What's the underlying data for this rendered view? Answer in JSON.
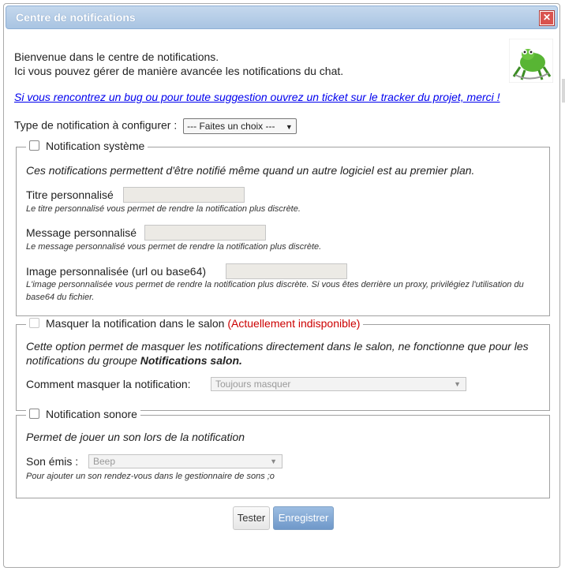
{
  "dialog": {
    "title": "Centre de notifications",
    "close_glyph": "✕"
  },
  "intro": {
    "line1": "Bienvenue dans le centre de notifications.",
    "line2": "Ici vous pouvez gérer de manière avancée les notifications du chat."
  },
  "bug_link": "Si vous rencontrez un bug ou pour toute suggestion ouvrez un ticket sur le tracker du projet, merci !",
  "type_select": {
    "label": "Type de notification à configurer :",
    "value": "--- Faites un choix ---"
  },
  "system": {
    "legend": "Notification système",
    "description": "Ces notifications permettent d'être notifié même quand un autre logiciel est au premier plan.",
    "title_label": "Titre personnalisé",
    "title_hint": "Le titre personnalisé vous permet de rendre la notification plus discrète.",
    "message_label": "Message personnalisé",
    "message_hint": "Le message personnalisé vous permet de rendre la notification plus discrète.",
    "image_label": "Image personnalisée (url ou base64)",
    "image_hint": "L'image personnalisée vous permet de rendre la notification plus discrète. Si vous êtes derrière un proxy, privilégiez l'utilisation du base64 du fichier."
  },
  "hide": {
    "legend": "Masquer la notification dans le salon",
    "unavailable": "(Actuellement indisponible)",
    "description": "Cette option permet de masquer les notifications directement dans le salon, ne fonctionne que pour les notifications du groupe",
    "description_bold": "Notifications salon.",
    "mode_label": "Comment masquer la notification:",
    "mode_value": "Toujours masquer"
  },
  "sound": {
    "legend": "Notification sonore",
    "description": "Permet de jouer un son lors de la notification",
    "sound_label": "Son émis :",
    "sound_value": "Beep",
    "hint": "Pour ajouter un son rendez-vous dans le gestionnaire de sons ;o"
  },
  "buttons": {
    "test": "Tester",
    "save": "Enregistrer"
  },
  "colors": {
    "titlebar": "#a9c4e2",
    "close": "#d9534f",
    "link": "#0000ee",
    "unavailable": "#cc0000",
    "save_button": "#7fa6d2"
  }
}
